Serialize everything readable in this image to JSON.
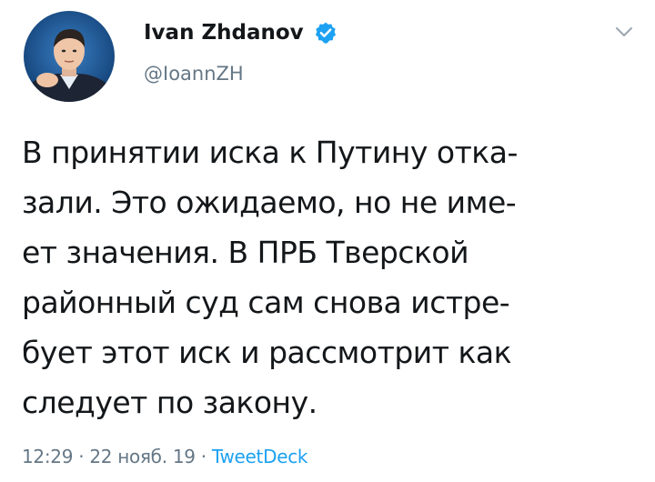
{
  "author": {
    "display_name": "Ivan Zhdanov",
    "handle": "@IoannZH",
    "verified": true,
    "avatar_icon": "profile-photo"
  },
  "tweet": {
    "lines": [
      "В принятии иска к Путину отка-",
      "зали. Это ожидаемо, но не име-",
      "ет значения. В ПРБ Тверской",
      "районный суд сам снова истре-",
      "бует этот иск и  рассмотрит как",
      "следует по закону."
    ]
  },
  "meta": {
    "time": "12:29",
    "separator1": " · ",
    "date": "22 нояб. 19",
    "separator2": " · ",
    "source": "TweetDeck"
  },
  "icons": {
    "verified": "verified-badge-icon",
    "caret": "chevron-down-icon"
  },
  "colors": {
    "text": "#14171a",
    "secondary": "#657786",
    "accent": "#1da1f2"
  }
}
